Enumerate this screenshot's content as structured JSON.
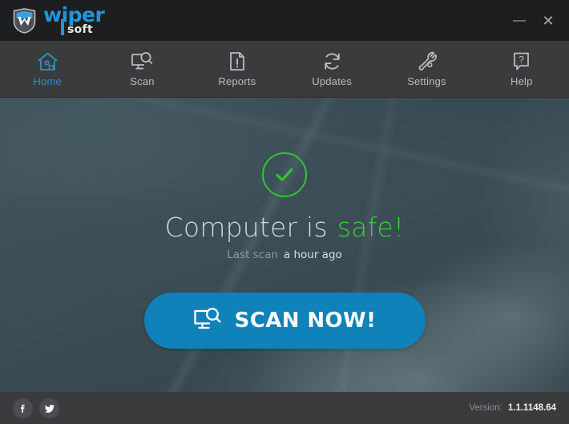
{
  "app": {
    "brand_primary": "wiper",
    "brand_secondary": "soft",
    "accent_blue": "#2196d8",
    "accent_green": "#3ece3e",
    "button_blue": "#0f82b9"
  },
  "titlebar": {
    "logo_icon": "shield-w-logo-icon",
    "minimize_label": "—",
    "minimize_icon": "minimize-icon",
    "close_label": "✕",
    "close_icon": "close-icon"
  },
  "nav": {
    "items": [
      {
        "id": "home",
        "label": "Home",
        "icon": "home-icon",
        "active": true
      },
      {
        "id": "scan",
        "label": "Scan",
        "icon": "scan-icon",
        "active": false
      },
      {
        "id": "reports",
        "label": "Reports",
        "icon": "reports-icon",
        "active": false
      },
      {
        "id": "updates",
        "label": "Updates",
        "icon": "updates-icon",
        "active": false
      },
      {
        "id": "settings",
        "label": "Settings",
        "icon": "settings-icon",
        "active": false
      },
      {
        "id": "help",
        "label": "Help",
        "icon": "help-icon",
        "active": false
      }
    ]
  },
  "main": {
    "status_icon": "check-circle-icon",
    "status_prefix": "Computer is",
    "status_word": "safe!",
    "lastscan_label": "Last scan",
    "lastscan_value": "a hour ago",
    "scan_button_label": "SCAN NOW!",
    "scan_button_icon": "monitor-search-icon"
  },
  "footer": {
    "facebook_glyph": "f",
    "facebook_icon": "facebook-icon",
    "twitter_icon": "twitter-icon",
    "version_label": "Version:",
    "version_value": "1.1.1148.64"
  }
}
